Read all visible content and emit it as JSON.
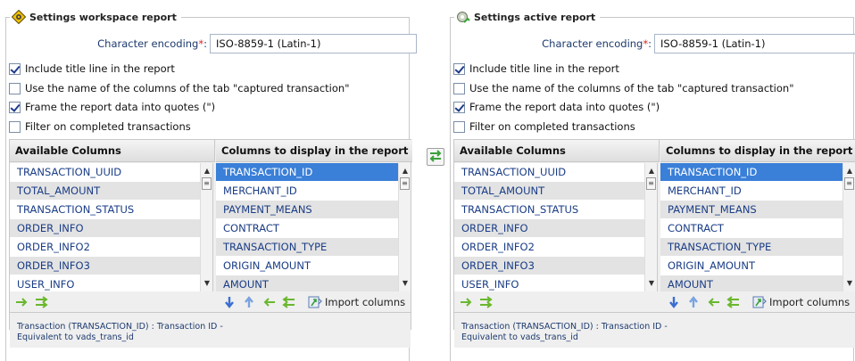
{
  "swap": {
    "icon": "swap-arrows-icon"
  },
  "panels": [
    {
      "title": "Settings workspace report",
      "icon": "gear-warning-icon",
      "encoding": {
        "label": "Character encoding",
        "required_mark": "*",
        "suffix": ":",
        "value": "ISO-8859-1 (Latin-1)"
      },
      "checks": [
        {
          "label": "Include title line in the report",
          "checked": true
        },
        {
          "label": "Use the name of the columns of the tab \"captured transaction\"",
          "checked": false
        },
        {
          "label": "Frame the report data into quotes (\")",
          "checked": true
        },
        {
          "label": "Filter on completed transactions",
          "checked": false
        }
      ],
      "available_header": "Available Columns",
      "display_header": "Columns to display in the report",
      "available_columns": [
        "TRANSACTION_UUID",
        "TOTAL_AMOUNT",
        "TRANSACTION_STATUS",
        "ORDER_INFO",
        "ORDER_INFO2",
        "ORDER_INFO3",
        "USER_INFO"
      ],
      "display_columns": [
        "TRANSACTION_ID",
        "MERCHANT_ID",
        "PAYMENT_MEANS",
        "CONTRACT",
        "TRANSACTION_TYPE",
        "ORIGIN_AMOUNT",
        "AMOUNT"
      ],
      "selected_display_index": 0,
      "import_label": "Import columns",
      "description_line1": "Transaction (TRANSACTION_ID) : Transaction ID -",
      "description_line2": "Equivalent to vads_trans_id"
    },
    {
      "title": "Settings active report",
      "icon": "gear-active-icon",
      "encoding": {
        "label": "Character encoding",
        "required_mark": "*",
        "suffix": ":",
        "value": "ISO-8859-1 (Latin-1)"
      },
      "checks": [
        {
          "label": "Include title line in the report",
          "checked": true
        },
        {
          "label": "Use the name of the columns of the tab \"captured transaction\"",
          "checked": false
        },
        {
          "label": "Frame the report data into quotes (\")",
          "checked": true
        },
        {
          "label": "Filter on completed transactions",
          "checked": false
        }
      ],
      "available_header": "Available Columns",
      "display_header": "Columns to display in the report",
      "available_columns": [
        "TRANSACTION_UUID",
        "TOTAL_AMOUNT",
        "TRANSACTION_STATUS",
        "ORDER_INFO",
        "ORDER_INFO2",
        "ORDER_INFO3",
        "USER_INFO"
      ],
      "display_columns": [
        "TRANSACTION_ID",
        "MERCHANT_ID",
        "PAYMENT_MEANS",
        "CONTRACT",
        "TRANSACTION_TYPE",
        "ORIGIN_AMOUNT",
        "AMOUNT"
      ],
      "selected_display_index": 0,
      "import_label": "Import columns",
      "description_line1": "Transaction (TRANSACTION_ID) : Transaction ID -",
      "description_line2": "Equivalent to vads_trans_id"
    }
  ],
  "colors": {
    "accent": "#3a7fd8",
    "link_text": "#1a3d86",
    "required": "#e02020",
    "stripe": "#e3e3e3"
  }
}
